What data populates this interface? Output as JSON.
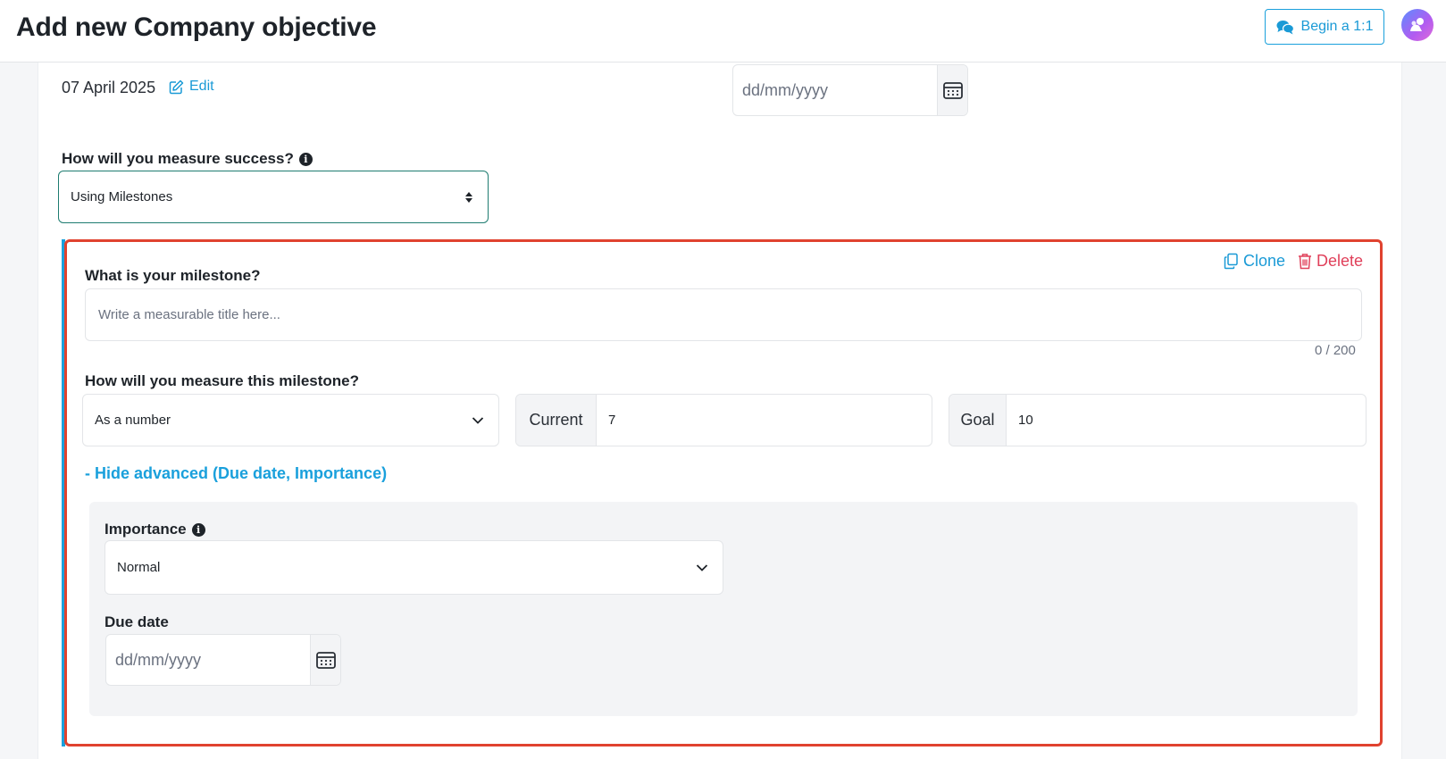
{
  "header": {
    "title": "Add new Company objective",
    "begin_button": "Begin a 1:1"
  },
  "objective": {
    "created_date": "07 April 2025",
    "edit_label": "Edit",
    "due_date_placeholder": "dd/mm/yyyy",
    "measure_label": "How will you measure success?",
    "measure_value": "Using Milestones"
  },
  "milestone": {
    "clone_label": "Clone",
    "delete_label": "Delete",
    "title_label": "What is your milestone?",
    "title_placeholder": "Write a measurable title here...",
    "char_counter": "0 / 200",
    "measure_label": "How will you measure this milestone?",
    "measure_type": "As a number",
    "current_label": "Current",
    "current_value": "7",
    "goal_label": "Goal",
    "goal_value": "10",
    "advanced_toggle": "- Hide advanced (Due date, Importance)",
    "importance_label": "Importance",
    "importance_value": "Normal",
    "due_date_label": "Due date",
    "due_date_placeholder": "dd/mm/yyyy"
  },
  "colors": {
    "accent": "#1aa0dc",
    "danger": "#e0405a",
    "highlight_border": "#e0422f",
    "select_border": "#1e7c70"
  }
}
